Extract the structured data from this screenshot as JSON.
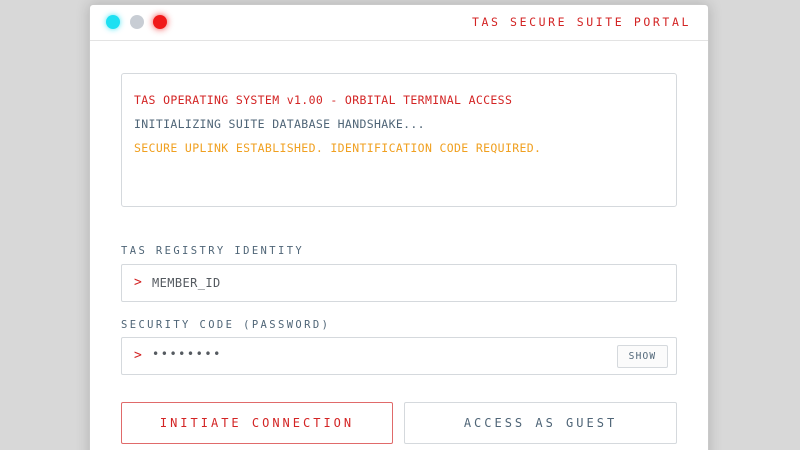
{
  "window": {
    "title": "TAS SECURE SUITE PORTAL",
    "controls": [
      "close-dot-cyan",
      "minimize-dot-gray",
      "maximize-dot-red"
    ]
  },
  "terminal": {
    "lines": [
      "TAS OPERATING SYSTEM v1.00 - ORBITAL TERMINAL ACCESS",
      "INITIALIZING SUITE DATABASE HANDSHAKE...",
      "SECURE UPLINK ESTABLISHED. IDENTIFICATION CODE REQUIRED."
    ]
  },
  "form": {
    "identity": {
      "label": "TAS REGISTRY IDENTITY",
      "prompt": ">",
      "placeholder": "MEMBER_ID"
    },
    "password": {
      "label": "SECURITY CODE (PASSWORD)",
      "prompt": ">",
      "value": "••••••••",
      "toggle_label": "SHOW"
    }
  },
  "actions": {
    "primary_label": "INITIATE CONNECTION",
    "secondary_label": "ACCESS AS GUEST"
  },
  "colors": {
    "accent_red": "#d32424",
    "slate": "#4f6577",
    "amber": "#f0a020",
    "cyan": "#1de0f2"
  }
}
